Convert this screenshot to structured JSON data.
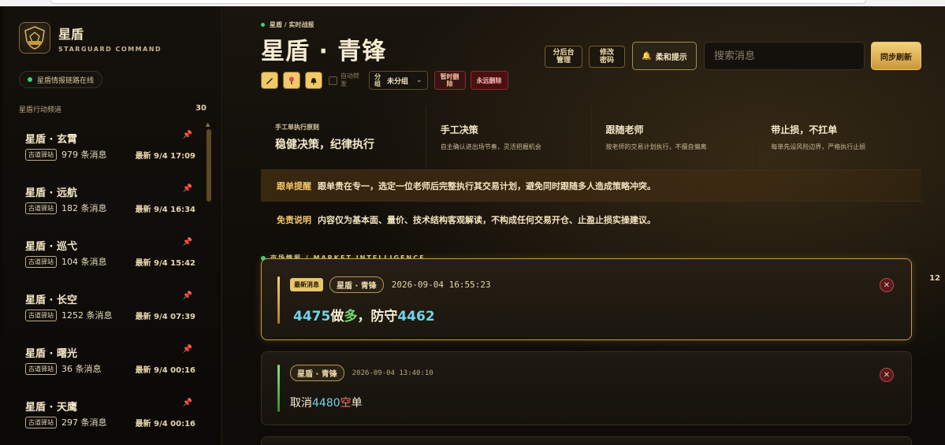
{
  "sidebar": {
    "brand_title": "星盾",
    "brand_subtitle": "STARGUARD COMMAND",
    "status_text": "星盾情报链路在线",
    "channels_label": "星盾行动频道",
    "channels_count": "30",
    "channels": [
      {
        "name": "星盾 · 玄霄",
        "tag": "古道驿站",
        "messages": "979 条消息",
        "latest": "最新 9/4 17:09"
      },
      {
        "name": "星盾 · 远航",
        "tag": "古道驿站",
        "messages": "182 条消息",
        "latest": "最新 9/4 16:34"
      },
      {
        "name": "星盾 · 巡弋",
        "tag": "古道驿站",
        "messages": "104 条消息",
        "latest": "最新 9/4 15:42"
      },
      {
        "name": "星盾 · 长空",
        "tag": "古道驿站",
        "messages": "1252 条消息",
        "latest": "最新 9/4 07:39"
      },
      {
        "name": "星盾 · 曙光",
        "tag": "古道驿站",
        "messages": "36 条消息",
        "latest": "最新 9/4 00:16"
      },
      {
        "name": "星盾 · 天鹰",
        "tag": "古道驿站",
        "messages": "297 条消息",
        "latest": "最新 9/4 00:16"
      }
    ]
  },
  "header": {
    "breadcrumb": "星盾 / 实时战报",
    "title": "星盾 · 青锋",
    "btn_admin": "分后台\n管理",
    "btn_password": "修改\n密码",
    "btn_soft_hint": "柔和提示",
    "search_placeholder": "搜索消息",
    "btn_sync": "同步刷新"
  },
  "toolbar": {
    "auto_translate": "自动转发",
    "group_label": "分组",
    "group_value": "未分组",
    "btn_temp_delete": "暂时删除",
    "btn_perm_delete": "永远删除"
  },
  "info": {
    "principle_kicker": "手工单执行原则",
    "principle_main": "稳健决策，纪律执行",
    "items": [
      {
        "title": "手工决策",
        "desc": "自主确认进出场节奏，灵活把握机会"
      },
      {
        "title": "跟随老师",
        "desc": "按老师的交易计划执行，不擅自偏离"
      },
      {
        "title": "带止损，不扛单",
        "desc": "每单先设风险边界，严格执行止损"
      }
    ],
    "notice_key": "跟单提醒",
    "notice_text": "跟单贵在专一，选定一位老师后完整执行其交易计划，避免同时跟随多人造成策略冲突。",
    "disclaimer_key": "免责说明",
    "disclaimer_text": "内容仅为基本面、量价、技术结构客观解读，不构成任何交易开仓、止盈止损实操建议。"
  },
  "intel": {
    "label": "市场情报 / MARKET INTELLIGENCE",
    "count": "12"
  },
  "messages": [
    {
      "badge": "最新消息",
      "channel": "星盾 · 青锋",
      "time": "2026-09-04 16:55:23",
      "parts": {
        "a": "4475",
        "b": "做",
        "c": "多",
        "d": "，防守",
        "e": "4462"
      }
    },
    {
      "channel": "星盾 · 青锋",
      "time": "2026-09-04 13:40:10",
      "parts": {
        "a": "取消",
        "b": "4480",
        "c": "空",
        "d": "单"
      }
    }
  ],
  "colors": {
    "accent_gold": "#f0c96a",
    "positive": "#72d86a",
    "negative": "#f37a6e",
    "number": "#6fd3e8"
  }
}
